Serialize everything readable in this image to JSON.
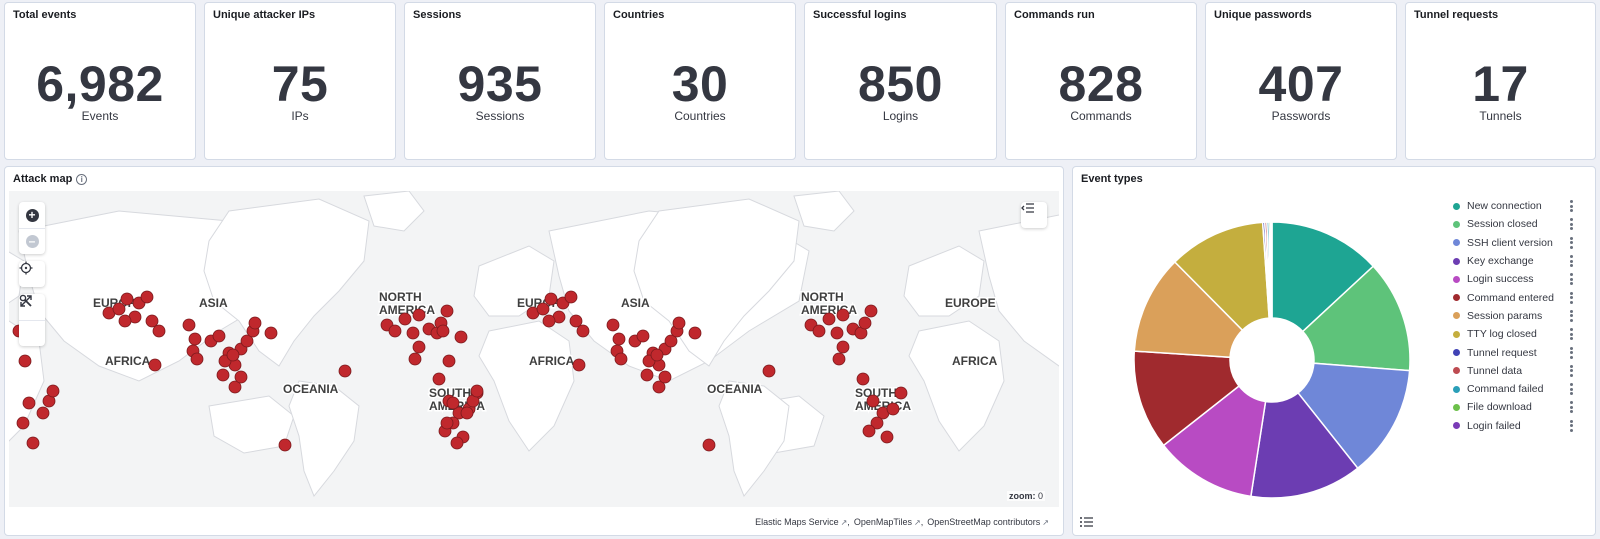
{
  "metrics": [
    {
      "title": "Total events",
      "value": "6,982",
      "label": "Events"
    },
    {
      "title": "Unique attacker IPs",
      "value": "75",
      "label": "IPs"
    },
    {
      "title": "Sessions",
      "value": "935",
      "label": "Sessions"
    },
    {
      "title": "Countries",
      "value": "30",
      "label": "Countries"
    },
    {
      "title": "Successful logins",
      "value": "850",
      "label": "Logins"
    },
    {
      "title": "Commands run",
      "value": "828",
      "label": "Commands"
    },
    {
      "title": "Unique passwords",
      "value": "407",
      "label": "Passwords"
    },
    {
      "title": "Tunnel requests",
      "value": "17",
      "label": "Tunnels"
    }
  ],
  "attack_map": {
    "title": "Attack map",
    "continent_labels": [
      "EUROPE",
      "ASIA",
      "AFRICA",
      "NORTH AMERICA",
      "SOUTH AMERICA",
      "OCEANIA"
    ],
    "zoom_label": "zoom:",
    "zoom_value": "0",
    "attribution": [
      "Elastic Maps Service",
      "OpenMapTiles",
      "OpenStreetMap contributors"
    ],
    "marker_color": "#c0282d"
  },
  "event_types": {
    "title": "Event types",
    "chart_data": {
      "type": "pie",
      "donut": true,
      "categories": [
        "New connection",
        "Session closed",
        "SSH client version",
        "Key exchange",
        "Login success",
        "Command entered",
        "Session params",
        "TTY log closed",
        "Tunnel request",
        "Tunnel data",
        "Command failed",
        "File download",
        "Login failed"
      ],
      "values": [
        13.4,
        13.4,
        13.4,
        13.4,
        12.2,
        11.9,
        11.8,
        11.6,
        0.25,
        0.25,
        0.25,
        0.2,
        0.15
      ],
      "colors": [
        "#1ea593",
        "#5ec37a",
        "#6f87d8",
        "#6c3db2",
        "#b84bc3",
        "#a02a2e",
        "#daa05a",
        "#c4ae3e",
        "#4042b5",
        "#bd4b51",
        "#2a9fb8",
        "#6cc04a",
        "#7a3bb7"
      ],
      "legend_position": "right"
    }
  }
}
